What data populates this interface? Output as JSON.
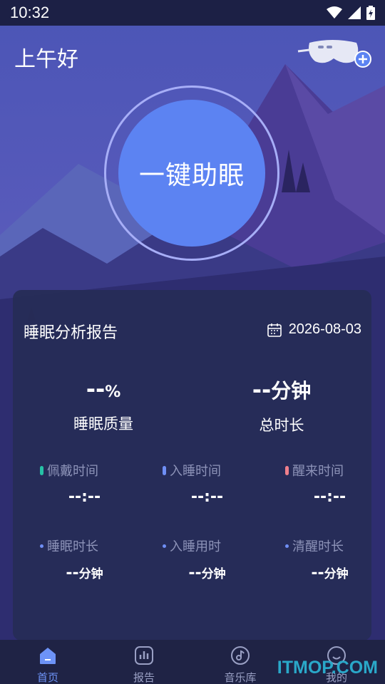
{
  "status_bar": {
    "time": "10:32"
  },
  "header": {
    "greeting": "上午好",
    "mask_icon": "sleep-mask-add-icon"
  },
  "sleep_button": {
    "label": "一键助眠"
  },
  "report": {
    "title": "睡眠分析报告",
    "date": "2026-08-03",
    "quality": {
      "value": "--",
      "unit": "%",
      "label": "睡眠质量"
    },
    "total": {
      "value": "--",
      "unit": "分钟",
      "label": "总时长"
    },
    "times": [
      {
        "label": "佩戴时间",
        "value": "--:--",
        "color": "#26c2a6"
      },
      {
        "label": "入睡时间",
        "value": "--:--",
        "color": "#6f8ff5"
      },
      {
        "label": "醒来时间",
        "value": "--:--",
        "color": "#f0808c"
      }
    ],
    "durations": [
      {
        "label": "睡眠时长",
        "value": "--",
        "unit": "分钟"
      },
      {
        "label": "入睡用时",
        "value": "--",
        "unit": "分钟"
      },
      {
        "label": "清醒时长",
        "value": "--",
        "unit": "分钟"
      }
    ]
  },
  "tabs": [
    {
      "label": "首页",
      "icon": "home-icon",
      "active": true
    },
    {
      "label": "报告",
      "icon": "chart-icon",
      "active": false
    },
    {
      "label": "音乐库",
      "icon": "music-icon",
      "active": false
    },
    {
      "label": "我的",
      "icon": "profile-icon",
      "active": false
    }
  ],
  "watermark": "ITMOP.COM",
  "colors": {
    "accent": "#5c83f2",
    "active_tab": "#6d93f7"
  }
}
